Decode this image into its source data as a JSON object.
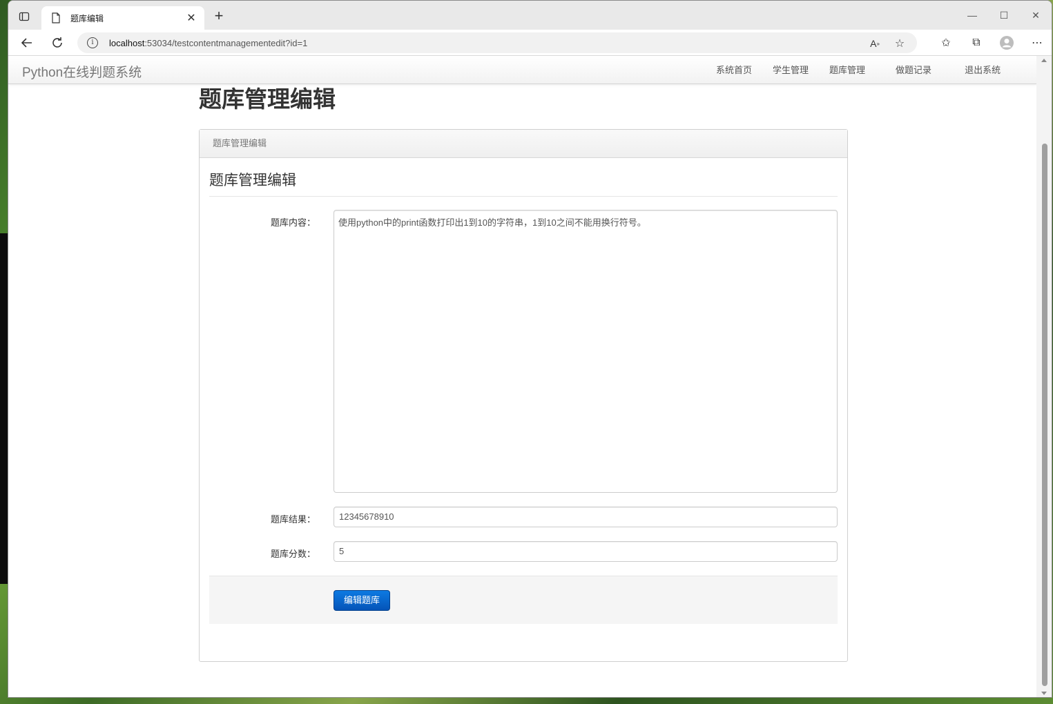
{
  "browser": {
    "tab_title": "题库编辑",
    "url_host": "localhost",
    "url_rest": ":53034/testcontentmanagementedit?id=1"
  },
  "navbar": {
    "brand": "Python在线判题系统",
    "links": [
      "系统首页",
      "学生管理",
      "题库管理",
      "做题记录",
      "退出系统"
    ]
  },
  "page": {
    "heading": "题库管理编辑",
    "panel_title": "题库管理编辑",
    "legend": "题库管理编辑"
  },
  "form": {
    "content_label": "题库内容：",
    "content_value": "使用python中的print函数打印出1到10的字符串，1到10之间不能用换行符号。",
    "result_label": "题库结果：",
    "result_value": "12345678910",
    "score_label": "题库分数：",
    "score_value": "5",
    "submit_label": "编辑题库"
  },
  "colors": {
    "primary_button": "#0a66cc",
    "navbar_bg": "#f5f5f5"
  }
}
